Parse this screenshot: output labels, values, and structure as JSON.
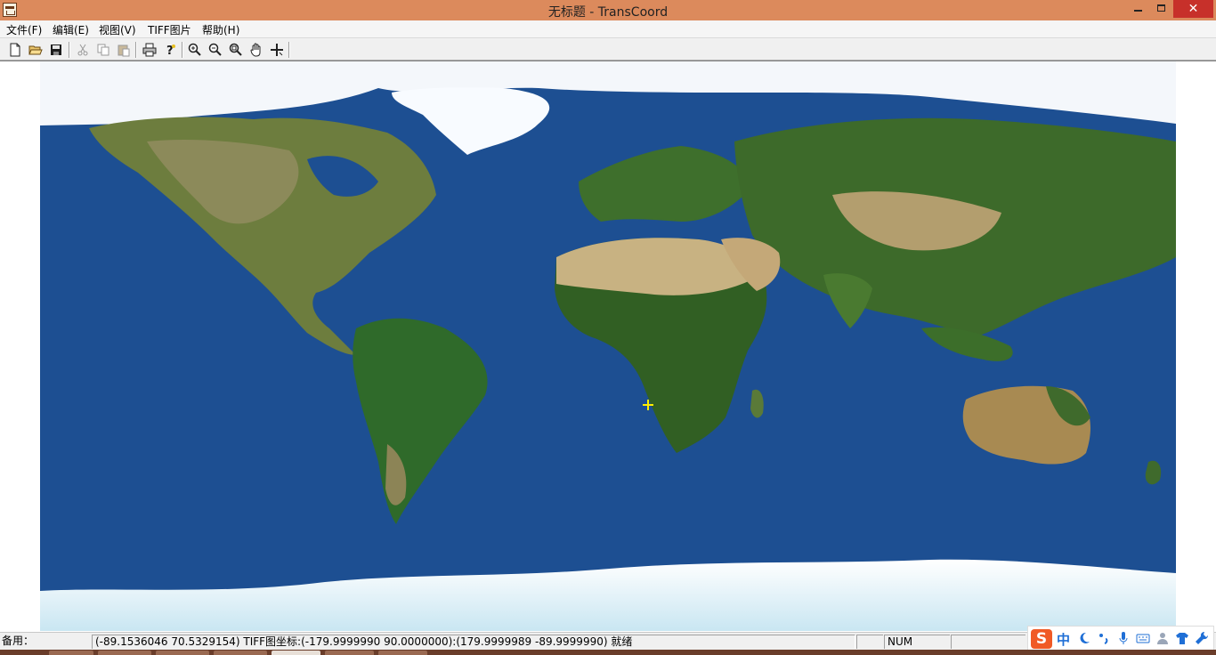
{
  "window": {
    "title": "无标题 - TransCoord",
    "close_symbol": "✕"
  },
  "menu": {
    "items": [
      {
        "label": "文件(F)"
      },
      {
        "label": "编辑(E)"
      },
      {
        "label": "视图(V)"
      },
      {
        "label": "TIFF图片"
      },
      {
        "label": "帮助(H)"
      }
    ]
  },
  "toolbar": {
    "buttons": [
      "new-file-icon",
      "open-folder-icon",
      "save-icon",
      "cut-icon",
      "copy-icon",
      "paste-icon",
      "print-icon",
      "help-icon",
      "zoom-in-icon",
      "zoom-out-icon",
      "zoom-fit-icon",
      "pan-hand-icon",
      "crosshair-tool-icon"
    ]
  },
  "map": {
    "image": "world satellite map",
    "marker": "yellow crosshair"
  },
  "statusbar": {
    "ready_label": "备用：",
    "coords_text": "(-89.1536046 70.5329154)  TIFF图坐标:(-179.9999990 90.0000000):(179.9999989 -89.9999990)  就绪",
    "num_label": "NUM"
  },
  "ime": {
    "logo": "S",
    "mode_label": "中"
  },
  "colors": {
    "titlebar": "#dc8a5c",
    "ocean": "#1d4f92",
    "close_button": "#c7302a",
    "marker": "#ffee00"
  }
}
